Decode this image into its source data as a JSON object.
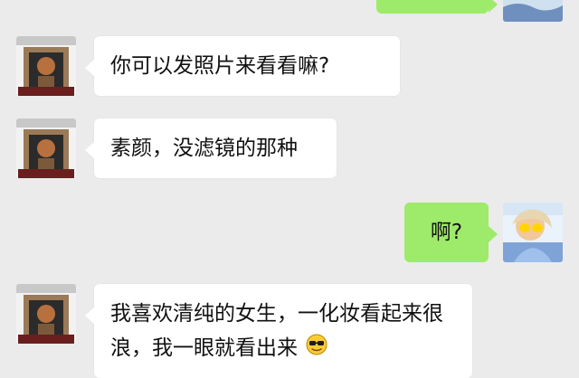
{
  "chat": {
    "messages": [
      {
        "side": "out",
        "text": ""
      },
      {
        "side": "in",
        "text": "你可以发照片来看看嘛?"
      },
      {
        "side": "in",
        "text": "素颜，没滤镜的那种"
      },
      {
        "side": "out",
        "text": "啊?"
      },
      {
        "side": "in",
        "text": "我喜欢清纯的女生，一化妆看起来很浪，我一眼就看出来",
        "emoji": "cool-sunglasses-emoji"
      }
    ]
  },
  "colors": {
    "background": "#ebebeb",
    "incoming_bubble": "#ffffff",
    "outgoing_bubble": "#9eea6a",
    "text": "#111111"
  }
}
